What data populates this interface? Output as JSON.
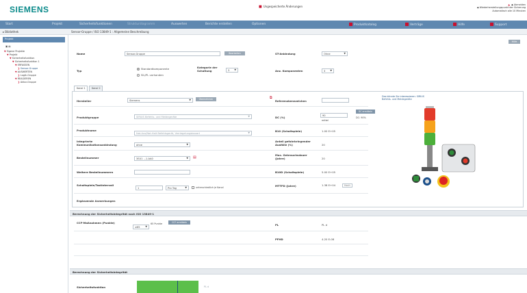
{
  "header": {
    "logo": "SIEMENS",
    "changes": "Ungespeicherte Änderungen",
    "logout": "Abmelden",
    "autosave": "Wiederherstellungspunkt der Sicherung",
    "autosave2": "Automatisch alle 10 Minuten"
  },
  "nav": {
    "items": [
      "Start",
      "Projekt",
      "Sicherheitsfunktionen",
      "Strukturdiagramm",
      "Auswerten",
      "Berichte erstellen",
      "Optionen"
    ],
    "right_items": [
      "Produktkatalog",
      "Verträge",
      "Hilfe",
      "Support"
    ]
  },
  "subbar": {
    "library": "Bibliothek",
    "breadcrumb": "Sensor-Gruppe / ISO 13849-1 : Allgemeine Beschreibung"
  },
  "tree": {
    "title": "Projekt",
    "items": [
      "Eigene Projekte",
      "Projekt",
      "Sicherheitsfunktion",
      "Sicherheitsfunktion 1",
      "ERFASSEN",
      "Sensor-Gruppe",
      "AUSWERTEN",
      "Logik-Gruppe",
      "REAGIEREN",
      "Aktor-Gruppe"
    ]
  },
  "main": {
    "help_label": "Hilfe",
    "name_label": "Name",
    "name_value": "Sensor-Gruppe",
    "change_button": "Bearbeiten",
    "st_label": "ST-Anbindung",
    "st_value": "Ohne",
    "typ_label": "Typ",
    "typ_opt1": "Standardkomponente",
    "typ_opt2": "SIL/PL vorhanden",
    "category_label": "Kategorie der Schaltung",
    "category_value": "3",
    "comp_count_label": "Anz. Komponenten",
    "comp_count_value": "3",
    "tabs": [
      "Kanal 1",
      "Kanal 2"
    ],
    "hersteller_label": "Hersteller",
    "hersteller_value": "Siemens",
    "hersteller_button": "Übernehmen",
    "ref_label": "Referenzkennzeichen",
    "ref_value": "",
    "image_caption": "Das könnte Sie interessieren: SIRIUS Befehls- und Meldegeräte",
    "produktgruppe_label": "Produktgruppe",
    "produktgruppe_value": "SIRIUS Befehls- und Meldegeräte",
    "dc_label": "DC (%)",
    "dc_value": "90",
    "dc_sub": "mittel",
    "dc_button": "DC ermitteln",
    "dc_percent": "DC: 90%",
    "produktname_label": "Produktname",
    "produktname_value": "Not-Aus/Not-Halt Befehlsgerät, Verriegelungsbauart",
    "b10_label": "B10 (Schaltspiele)",
    "b10_value": "1.00 E+05",
    "integration_label": "Integrierte Kommunikationsanbindung",
    "integration_value": "ohne",
    "failure_label": "Anteil gefahrbringender Ausfälle (%)",
    "failure_value": "20",
    "bestell_label": "Bestellnummer",
    "bestell_value": "3SU1 ...1.AA0",
    "max_label": "Max. Gebrauchsdauer (Jahre)",
    "max_value": "20",
    "weitere_label": "Weitere Bestellnummern",
    "b10d_label": "B10D (Schaltspiele)",
    "b10d_value": "5.00 E+05",
    "schalt_label": "Schaltspiele/Tastintervall",
    "schalt_value": "1",
    "schalt_unit": "Pro Tag",
    "schalt_check": "unterschiedlich je Kanal",
    "mttfd_label": "MTTFD (Jahre)",
    "mttfd_value": "1.38 E+04",
    "mttfd_button": "Hoch",
    "erg_label": "Ergänzende Anmerkungen",
    "sect1": "Berechnung der Sicherheitsintegrität nach ISO 13849-1",
    "ccf_label": "CCF-Maßnahmen (Punkte)",
    "ccf_value": "≥65",
    "ccf_unit": "65 Punkte",
    "ccf_button": "CCF ermitteln",
    "pl_label": "PL",
    "pl_value": "PL d",
    "pfhd_label": "PFHD",
    "pfhd_value": "4.20 E-08",
    "sect2": "Berechnung der Sicherheitsintegrität",
    "sicher_label": "Sicherheitsfunktion",
    "sicher_value": "PL d"
  },
  "colors": {
    "nav": "#5f88b0",
    "brand": "#0a8a8a",
    "accent": "#c8102e",
    "bar": "#5cbf4a"
  }
}
